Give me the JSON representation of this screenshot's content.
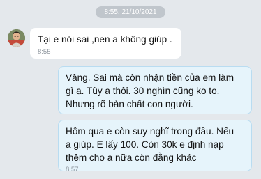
{
  "chat": {
    "date_separator": "8:55, 21/10/2021",
    "messages": [
      {
        "direction": "incoming",
        "sender_avatar": "user-avatar",
        "text": "Tại e nói sai ,nen a không giúp .",
        "time": "8:55"
      },
      {
        "direction": "outgoing",
        "text": "Vâng. Sai mà còn nhận tiền của em làm\ngì ạ. Tùy a thôi. 30 nghìn cũng ko to.\nNhưng rõ bản chất con người.",
        "time": ""
      },
      {
        "direction": "outgoing",
        "text": "Hôm qua e còn suy nghĩ trong đầu. Nếu\na giúp. E lấy 100. Còn 30k e định nạp\nthêm cho a nữa còn đằng khác",
        "time": "8:57"
      }
    ]
  },
  "colors": {
    "background": "#e4e8ec",
    "incoming_bubble": "#ffffff",
    "outgoing_bubble": "#e6f4fb",
    "outgoing_border": "#b9dcf1",
    "date_pill": "#c0c6cc"
  }
}
